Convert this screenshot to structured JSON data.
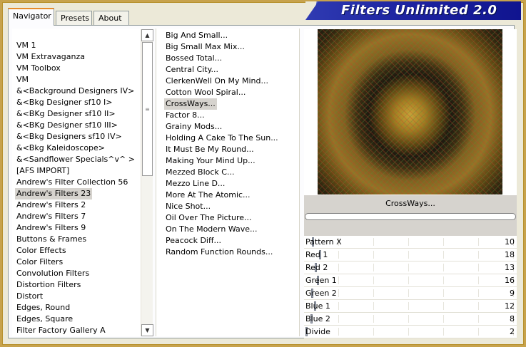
{
  "tabs": {
    "navigator": "Navigator",
    "presets": "Presets",
    "about": "About"
  },
  "banner": {
    "title": "Filters Unlimited 2.0"
  },
  "categories": [
    "VM 1",
    "VM Extravaganza",
    "VM Toolbox",
    "VM",
    "&<Background Designers IV>",
    "&<Bkg Designer sf10 I>",
    "&<BKg Designer sf10 II>",
    "&<BKg Designer sf10 III>",
    "&<Bkg Designers sf10 IV>",
    "&<Bkg Kaleidoscope>",
    "&<Sandflower Specials^v^ >",
    "[AFS IMPORT]",
    "Andrew's Filter Collection 56",
    "Andrew's Filters 23",
    "Andrew's Filters 2",
    "Andrew's Filters 7",
    "Andrew's Filters 9",
    "Buttons & Frames",
    "Color Effects",
    "Color Filters",
    "Convolution Filters",
    "Distortion Filters",
    "Distort",
    "Edges, Round",
    "Edges, Square",
    "Filter Factory Gallery A"
  ],
  "selected_category": "Andrew's Filters 23",
  "filters": [
    "Big And Small...",
    "Big Small Max Mix...",
    "Bossed Total...",
    "Central City...",
    "ClerkenWell On My Mind...",
    "Cotton Wool Spiral...",
    "CrossWays...",
    "Factor 8...",
    "Grainy Mods...",
    "Holding A Cake To The Sun...",
    "It Must Be My Round...",
    "Making Your Mind Up...",
    "Mezzed Block C...",
    "Mezzo Line D...",
    "More At The Atomic...",
    "Nice Shot...",
    "Oil Over The Picture...",
    "On The Modern Wave...",
    "Peacock Diff...",
    "Random Function Rounds..."
  ],
  "selected_filter": "CrossWays...",
  "filter_name": "CrossWays...",
  "progress": 0,
  "params": [
    {
      "label": "Pattern X",
      "value": "10"
    },
    {
      "label": "Red 1",
      "value": "18"
    },
    {
      "label": "Red 2",
      "value": "13"
    },
    {
      "label": "Green 1",
      "value": "16"
    },
    {
      "label": "Green 2",
      "value": "9"
    },
    {
      "label": "Blue 1",
      "value": "12"
    },
    {
      "label": "Blue 2",
      "value": "8"
    },
    {
      "label": "Divide",
      "value": "2"
    }
  ],
  "param_max": 255,
  "icons": {
    "scroll_up": "up-arrow-icon",
    "scroll_down": "down-arrow-icon",
    "scroll_grip": "grip-icon"
  },
  "colors": {
    "banner": "#1f26a3",
    "selection": "#d6d3ce",
    "active_tab_accent": "#e68b2c"
  }
}
